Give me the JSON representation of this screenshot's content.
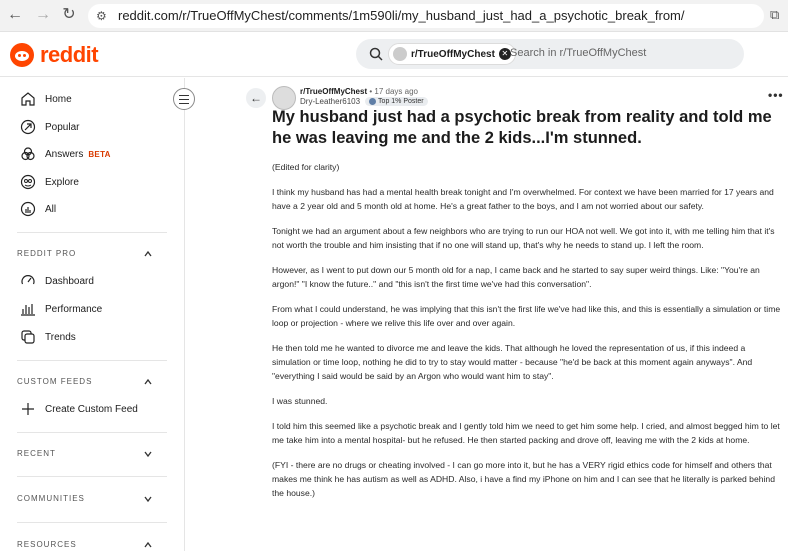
{
  "browser": {
    "url": "reddit.com/r/TrueOffMyChest/comments/1m590li/my_husband_just_had_a_psychotic_break_from/"
  },
  "header": {
    "logo_text": "reddit",
    "search_chip": "r/TrueOffMyChest",
    "search_placeholder": "Search in r/TrueOffMyChest"
  },
  "sidebar": {
    "nav": [
      {
        "label": "Home",
        "icon": "home-icon"
      },
      {
        "label": "Popular",
        "icon": "popular-icon"
      },
      {
        "label": "Answers",
        "icon": "answers-icon",
        "badge": "BETA"
      },
      {
        "label": "Explore",
        "icon": "explore-icon"
      },
      {
        "label": "All",
        "icon": "all-icon"
      }
    ],
    "reddit_pro": {
      "title": "REDDIT PRO",
      "items": [
        {
          "label": "Dashboard",
          "icon": "dashboard-icon"
        },
        {
          "label": "Performance",
          "icon": "performance-icon"
        },
        {
          "label": "Trends",
          "icon": "trends-icon"
        }
      ]
    },
    "custom_feeds": {
      "title": "CUSTOM FEEDS",
      "items": [
        {
          "label": "Create Custom Feed",
          "icon": "plus-icon"
        }
      ]
    },
    "recent_title": "RECENT",
    "communities_title": "COMMUNITIES",
    "resources_title": "RESOURCES"
  },
  "post": {
    "subreddit": "r/TrueOffMyChest",
    "separator": "•",
    "time": "17 days ago",
    "author": "Dry-Leather6103",
    "badge": "Top 1% Poster",
    "more": "•••",
    "title": "My husband just had a psychotic break from reality and told me he was leaving me and the 2 kids...I'm stunned.",
    "paragraphs": [
      "(Edited for clarity)",
      "I think my husband has had a mental health break tonight and I'm overwhelmed. For context we have been married for 17 years and have a 2 year old and 5 month old at home. He's a great father to the boys, and I am not worried about our safety.",
      "Tonight we had an argument about a few neighbors who are trying to run our HOA not well. We got into it, with me telling him that it's not worth the trouble and him insisting that if no one will stand up, that's why he needs to stand up. I left the room.",
      "However, as I went to put down our 5 month old for a nap, I came back and he started to say super weird things. Like: \"You're an argon!\" \"I know the future..\" and \"this isn't the first time we've had this conversation\".",
      "From what I could understand, he was implying that this isn't the first life we've had like this, and this is essentially a simulation or time loop or projection - where we relive this life over and over again.",
      "He then told me he wanted to divorce me and leave the kids. That although he loved the representation of us, if this indeed a simulation or time loop, nothing he did to try to stay would matter - because \"he'd be back at this moment again anyways\". And \"everything I said would be said by an Argon who would want him to stay\".",
      "I was stunned.",
      "I told him this seemed like a psychotic break and I gently told him we need to get him some help. I cried, and almost begged him to let me take him into a mental hospital- but he refused. He then started packing and drove off, leaving me with the 2 kids at home.",
      "(FYI - there are no drugs or cheating involved - I can go more into it, but he has a VERY rigid ethics code for himself and others that makes me think he has autism as well as ADHD. Also, i have a find my iPhone on him and I can see that he literally is parked behind the house.)"
    ]
  }
}
